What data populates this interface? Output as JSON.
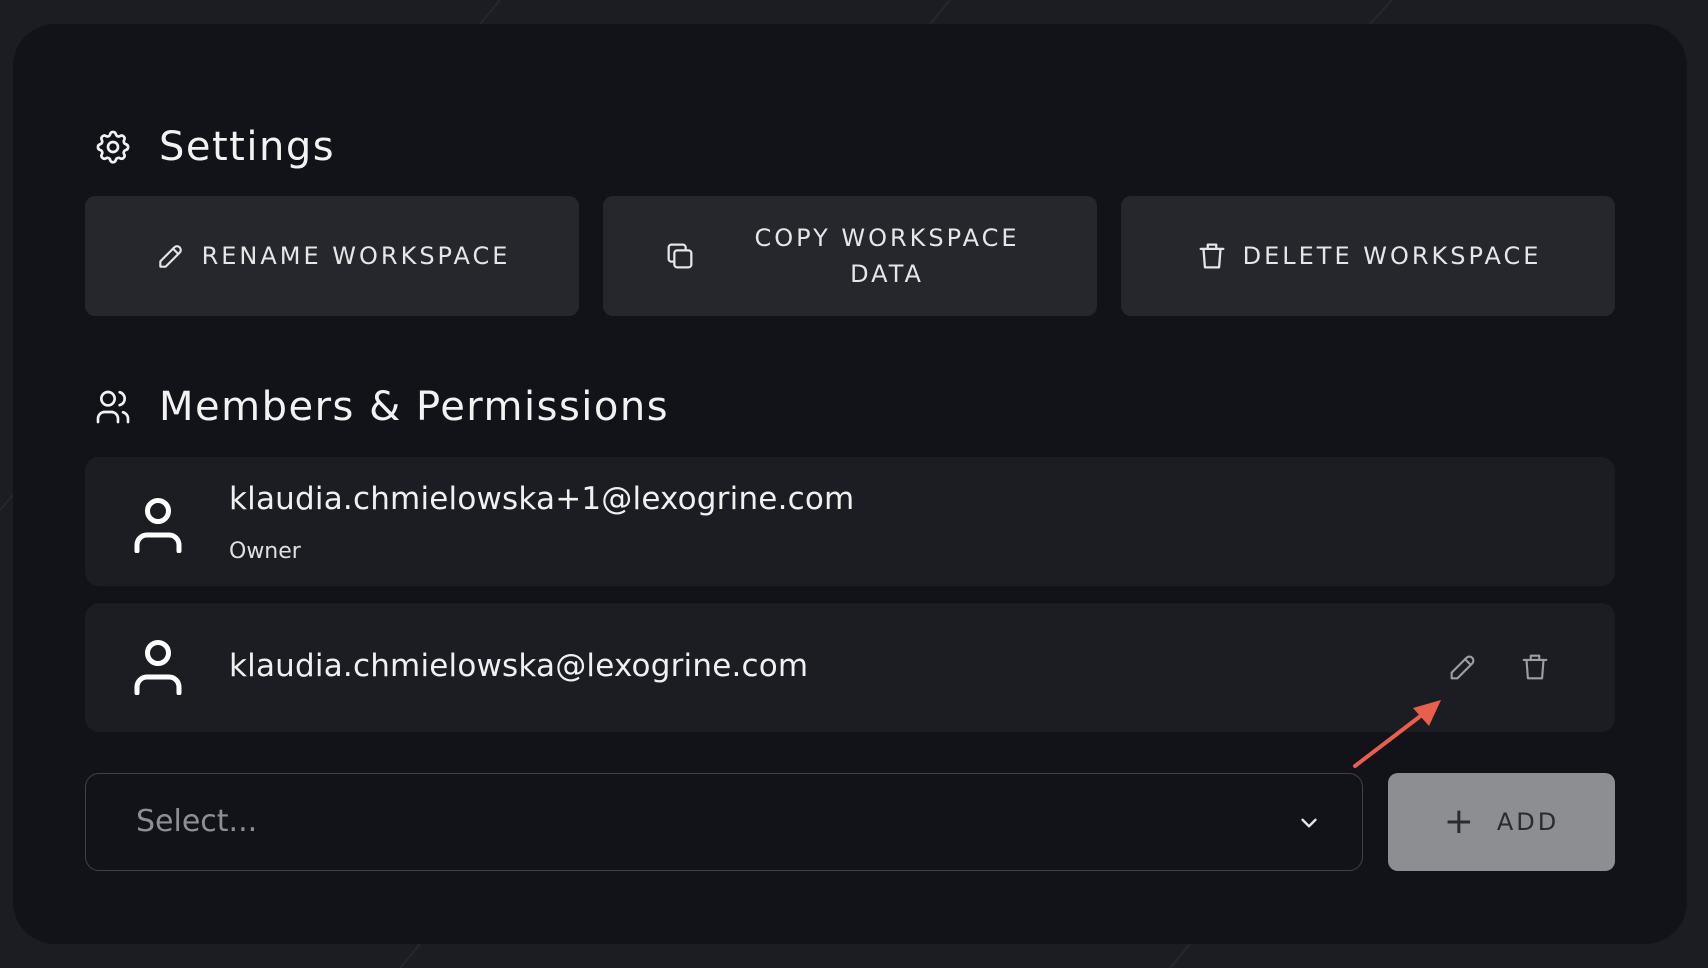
{
  "settings": {
    "title": "Settings",
    "icon": "gear-icon",
    "actions": {
      "rename_label": "RENAME WORKSPACE",
      "copy_label": "COPY WORKSPACE DATA",
      "delete_label": "DELETE WORKSPACE"
    }
  },
  "members": {
    "title": "Members & Permissions",
    "icon": "users-icon",
    "items": [
      {
        "email": "klaudia.chmielowska+1@lexogrine.com",
        "role": "Owner"
      },
      {
        "email": "klaudia.chmielowska@lexogrine.com",
        "role": ""
      }
    ]
  },
  "add_member": {
    "select_placeholder": "Select...",
    "add_label": "ADD"
  },
  "colors": {
    "background": "#1b1d22",
    "panel": "#121318",
    "button": "#25272d",
    "member_row": "#1c1d22",
    "add_button": "#8d8e91",
    "annotation_arrow": "#e8604c"
  }
}
